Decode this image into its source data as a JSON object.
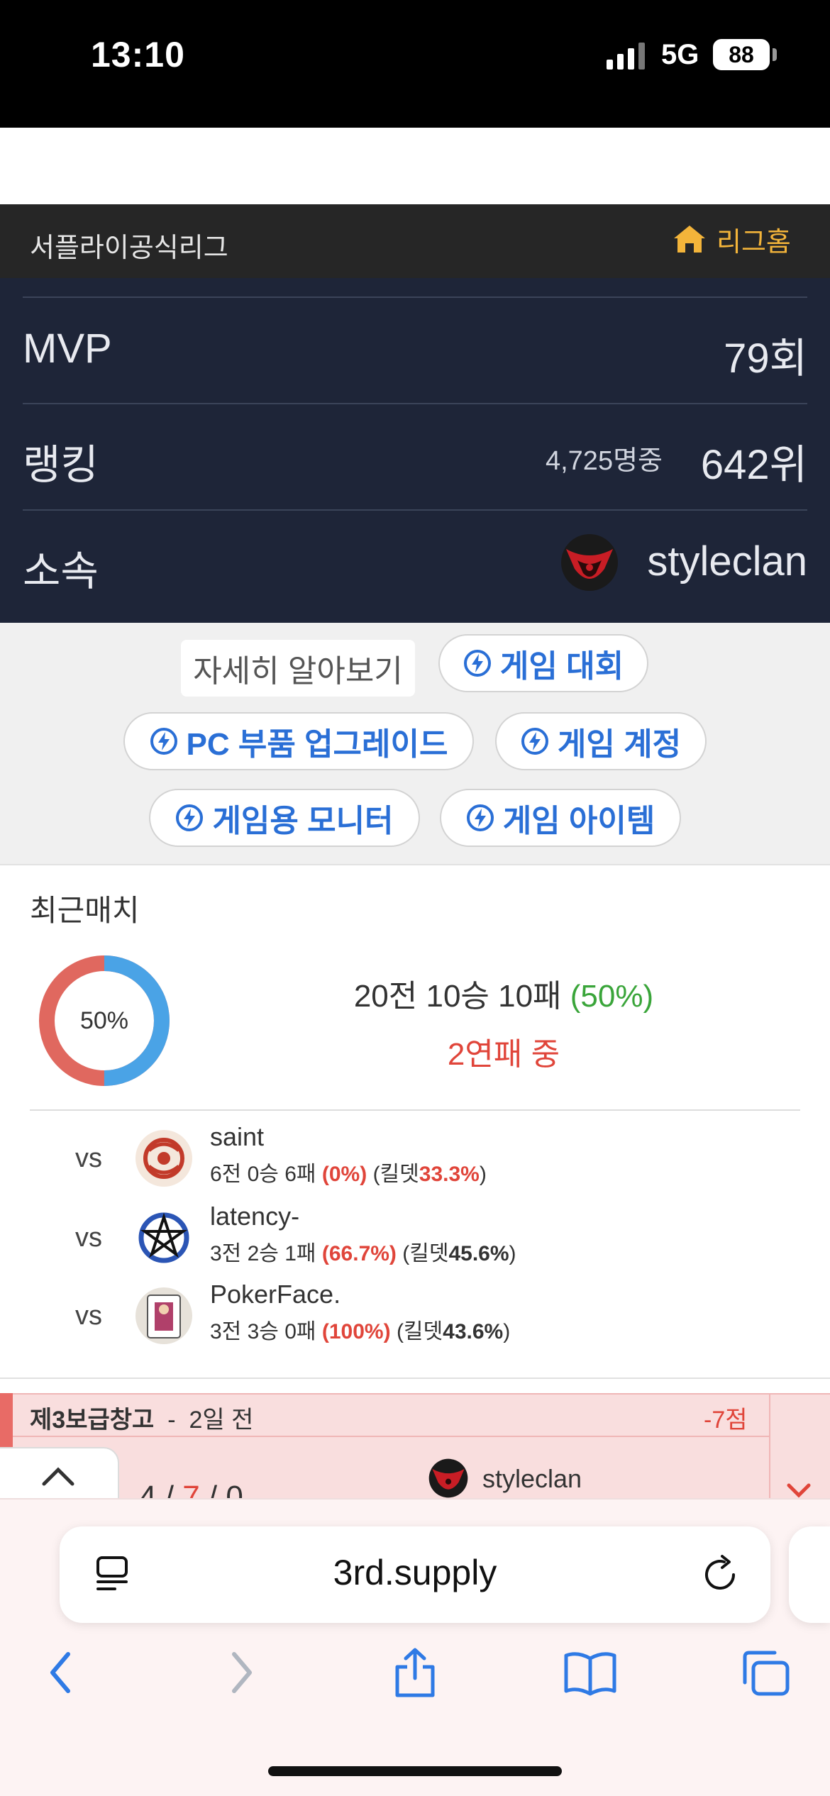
{
  "status_bar": {
    "time": "13:10",
    "network": "5G",
    "battery": "88"
  },
  "header": {
    "league_title": "서플라이공식리그",
    "home_link": "리그홈"
  },
  "stats": {
    "mvp_label": "MVP",
    "mvp_value": "79회",
    "rank_label": "랭킹",
    "rank_total": "4,725명중",
    "rank_value": "642위",
    "clan_label": "소속",
    "clan_name": "styleclan"
  },
  "ads": {
    "learn_more": "자세히 알아보기",
    "buttons": [
      "게임 대회",
      "PC 부품 업그레이드",
      "게임 계정",
      "게임용 모니터",
      "게임 아이템"
    ]
  },
  "recent": {
    "title": "최근매치",
    "win_rate": "50%",
    "win_fraction": 0.5,
    "record": "20전 10승 10패",
    "record_pct": "(50%)",
    "streak": "2연패 중",
    "opponents": [
      {
        "vs": "vs",
        "name": "saint",
        "record": "6전 0승 6패",
        "pct": "(0%)",
        "kd_label": "(킬뎃",
        "kd": "33.3%",
        "close": ")"
      },
      {
        "vs": "vs",
        "name": "latency-",
        "record": "3전 2승 1패",
        "pct": "(66.7%)",
        "kd_label": "(킬뎃",
        "kd": "45.6%",
        "close": ")"
      },
      {
        "vs": "vs",
        "name": "PokerFace.",
        "record": "3전 3승 0패",
        "pct": "(100%)",
        "kd_label": "(킬뎃",
        "kd": "43.6%",
        "close": ")"
      }
    ]
  },
  "match": {
    "map": "제3보급창고",
    "separator": "-",
    "time_ago": "2일 전",
    "points": "-7점",
    "kills": "4",
    "deaths": "7",
    "assists": "0",
    "slash": "/",
    "clan": "styleclan"
  },
  "browser": {
    "url": "3rd.supply"
  },
  "colors": {
    "accent": "#2a6fd6",
    "loss": "#e0453a",
    "win": "#3aa53a",
    "home_link": "#f3b43a",
    "panel": "#1e2538"
  }
}
